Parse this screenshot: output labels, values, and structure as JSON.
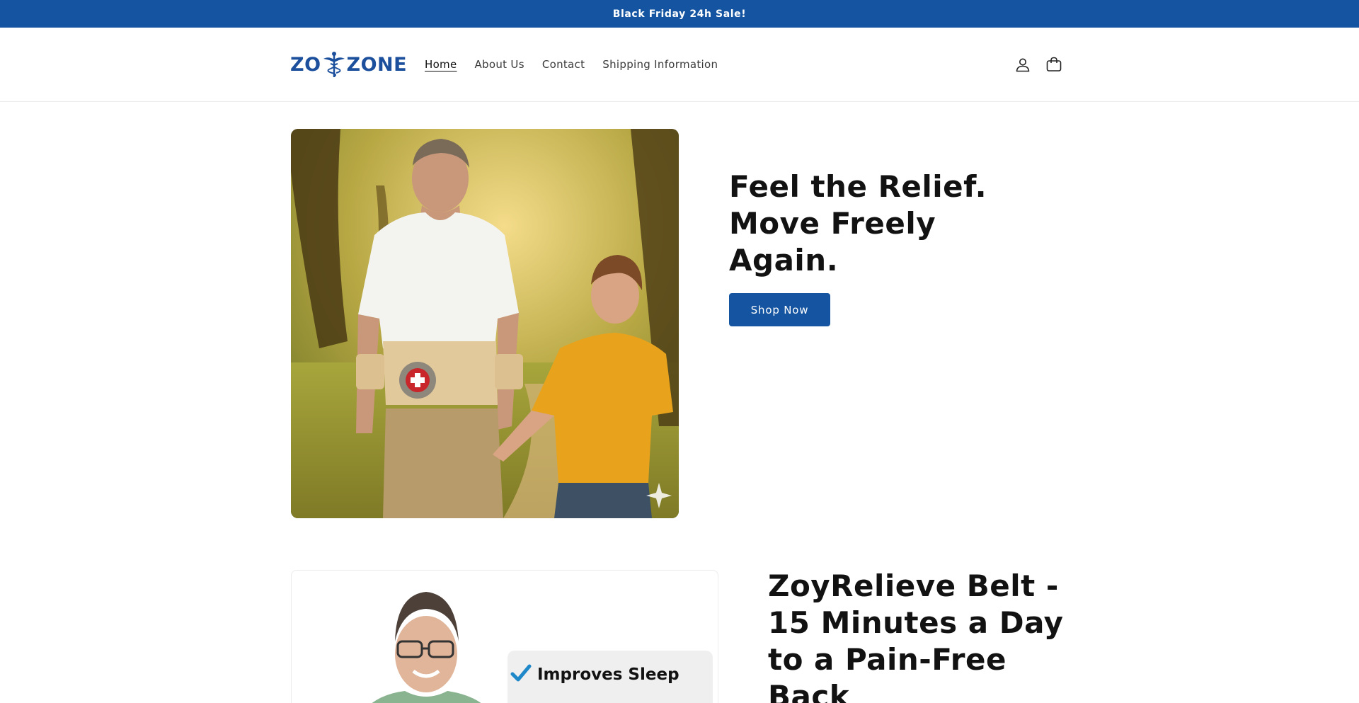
{
  "announcement": {
    "text": "Black Friday 24h Sale!"
  },
  "header": {
    "logo_text_left": "ZO",
    "logo_text_right": "ZONE",
    "nav": [
      {
        "label": "Home",
        "active": true
      },
      {
        "label": "About Us"
      },
      {
        "label": "Contact"
      },
      {
        "label": "Shipping Information"
      }
    ],
    "icons": {
      "account": "account-icon",
      "cart": "cart-icon"
    }
  },
  "hero": {
    "title_line1": "Feel the Relief.",
    "title_line2": "Move Freely Again.",
    "cta_label": "Shop Now"
  },
  "product": {
    "title": "ZoyRelieve Belt - 15 Minutes a Day to a Pain-Free Back",
    "benefits": [
      "Improves Sleep"
    ]
  },
  "colors": {
    "brand": "#1454a0",
    "logo": "#1c4f9c",
    "text": "#121212",
    "check": "#1e88c8"
  }
}
